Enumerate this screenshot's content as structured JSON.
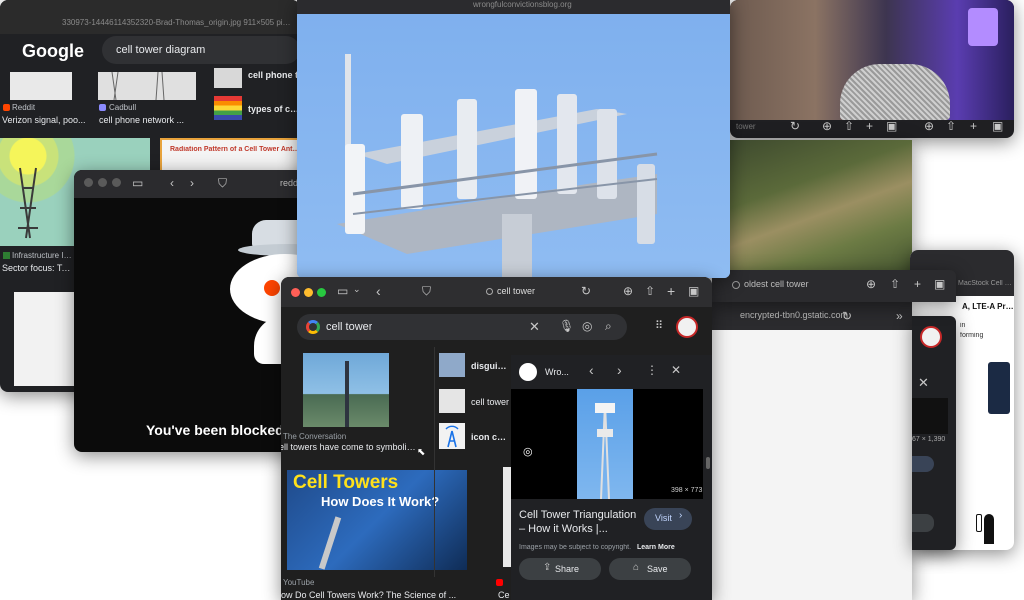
{
  "w1": {
    "url": "330973-14446114352320-Brad-Thomas_origin.jpg 911×505 pixels",
    "logo": "Google",
    "query": "cell tower diagram",
    "r1_src": "Reddit",
    "r1_title": "Verizon signal, poo...",
    "r2_src": "Cadbull",
    "r2_title": "cell phone network ...",
    "side1": "cell phone t",
    "side2": "types of cell",
    "radiation_title": "Radiation Pattern of a Cell Tower Antenna",
    "r3_src": "Infrastructure Inves",
    "r3_title": "Sector focus: Telec"
  },
  "w2": {
    "url": "reddi",
    "blocked": "You've been blocked"
  },
  "w3": {
    "url": "wrongfulconvictionsblog.org"
  },
  "w4": {
    "url": "tower"
  },
  "w5": {
    "url": "oldest cell tower"
  },
  "w6": {
    "url": "encrypted-tbn0.gstatic.com"
  },
  "w7": {
    "url": "MacStock Cell Tow",
    "dims": "67 × 1,390",
    "lte": "A, LTE-A Pro a",
    "frag1": "in",
    "frag2": "forming"
  },
  "w8": {
    "url": "cell tower",
    "search": "cell tower",
    "t1_src": "The Conversation",
    "t1_title": "ell towers have come to symbolize...",
    "mid1": "disguised",
    "mid2": "cell tower",
    "mid3": "icon cell to",
    "yt_title1": "Cell Towers",
    "yt_title2": "How Does It Work?",
    "yt_src": "YouTube",
    "yt_caption": "ow Do Cell Towers Work? The Science of ...",
    "yt_side": "Ce",
    "panel_src": "Wro...",
    "panel_dims": "398 × 773",
    "panel_title": "Cell Tower Triangulation – How it Works |...",
    "visit": "Visit",
    "copyright": "Images may be subject to copyright.",
    "learn_more": "Learn More",
    "share": "Share",
    "save": "Save"
  }
}
